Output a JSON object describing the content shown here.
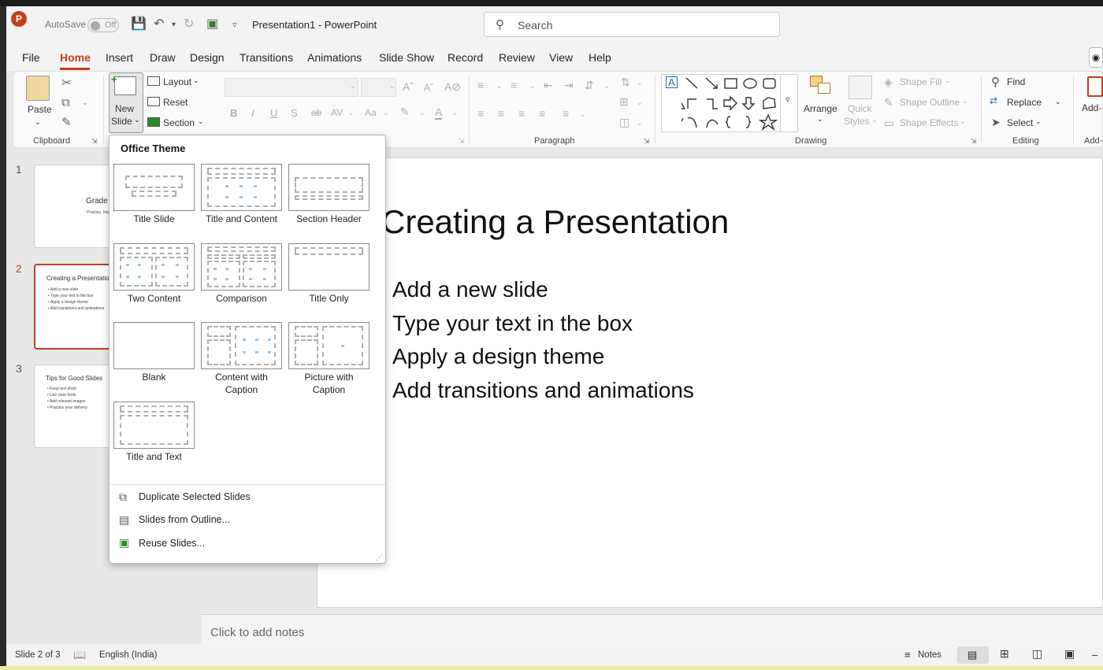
{
  "titlebar": {
    "app_icon": "P",
    "autosave_label": "AutoSave",
    "autosave_state": "Off",
    "document_title": "Presentation1  -  PowerPoint",
    "search_placeholder": "Search"
  },
  "tabs": [
    "File",
    "Home",
    "Insert",
    "Draw",
    "Design",
    "Transitions",
    "Animations",
    "Slide Show",
    "Record",
    "Review",
    "View",
    "Help"
  ],
  "active_tab": "Home",
  "ribbon": {
    "clipboard": {
      "paste": "Paste",
      "group": "Clipboard"
    },
    "slides": {
      "new_slide_1": "New",
      "new_slide_2": "Slide",
      "layout": "Layout",
      "reset": "Reset",
      "section": "Section"
    },
    "paragraph": {
      "group": "Paragraph"
    },
    "drawing": {
      "group": "Drawing",
      "arrange": "Arrange",
      "quick_styles_1": "Quick",
      "quick_styles_2": "Styles",
      "shape_fill": "Shape Fill",
      "shape_outline": "Shape Outline",
      "shape_effects": "Shape Effects"
    },
    "editing": {
      "group": "Editing",
      "find": "Find",
      "replace": "Replace",
      "select": "Select"
    },
    "addins": {
      "label": "Add-",
      "group": "Add-"
    }
  },
  "slides_panel": [
    {
      "num": "1",
      "title": "Grade",
      "sub": "Practice, Impr"
    },
    {
      "num": "2",
      "title": "Creating a Presentation",
      "bullets": [
        "• Add a new slide",
        "• Type your text in the box",
        "• Apply a design theme",
        "• Add transitions and animations"
      ]
    },
    {
      "num": "3",
      "title": "Tips for Good Slides",
      "bullets": [
        "• Keep text short",
        "• Use clear fonts",
        "• Add relevant images",
        "• Practice your delivery"
      ]
    }
  ],
  "slide": {
    "title": "Creating a Presentation",
    "bullets": [
      "Add a new slide",
      "Type your text in the box",
      "Apply a design theme",
      "Add transitions and animations"
    ]
  },
  "notes_placeholder": "Click to add notes",
  "status": {
    "slide": "Slide 2 of 3",
    "language": "English (India)",
    "notes": "Notes"
  },
  "dropdown": {
    "header": "Office Theme",
    "layouts": [
      {
        "name": "Title Slide"
      },
      {
        "name": "Title and Content"
      },
      {
        "name": "Section Header"
      },
      {
        "name": "Two Content"
      },
      {
        "name": "Comparison"
      },
      {
        "name": "Title Only"
      },
      {
        "name": "Blank"
      },
      {
        "name": "Content with Caption"
      },
      {
        "name": "Picture with Caption"
      },
      {
        "name": "Title and Text"
      }
    ],
    "options": [
      "Duplicate Selected Slides",
      "Slides from Outline...",
      "Reuse Slides..."
    ]
  },
  "colors": {
    "accent": "#c43e1c",
    "selected_border": "#c43e1c"
  }
}
